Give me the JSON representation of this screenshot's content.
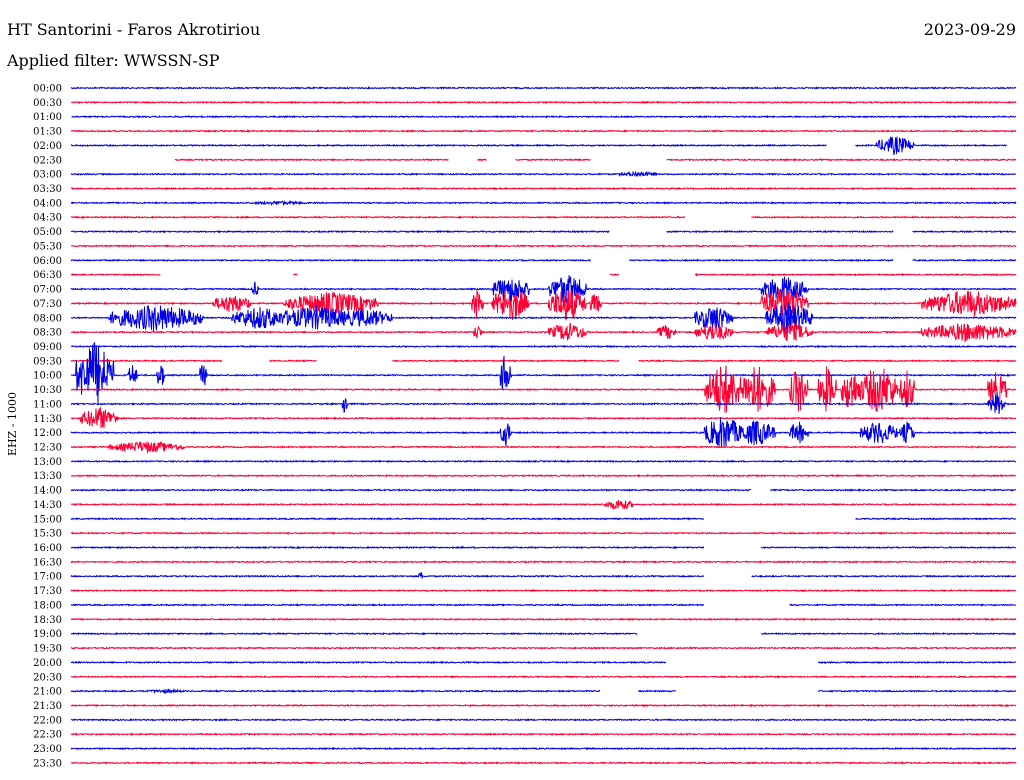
{
  "header": {
    "station": "HT Santorini - Faros Akrotiriou",
    "date": "2023-09-29",
    "filter": "Applied filter: WWSSN-SP"
  },
  "chart_data": {
    "type": "line",
    "title": "HT Santorini - Faros Akrotiriou",
    "subtitle": "Applied filter: WWSSN-SP",
    "ylabel": "EHZ - 1000",
    "colors": [
      "#0000e6",
      "#ff0033"
    ],
    "rows": [
      "00:00",
      "00:30",
      "01:00",
      "01:30",
      "02:00",
      "02:30",
      "03:00",
      "03:30",
      "04:00",
      "04:30",
      "05:00",
      "05:30",
      "06:00",
      "06:30",
      "07:00",
      "07:30",
      "08:00",
      "08:30",
      "09:00",
      "09:30",
      "10:00",
      "10:30",
      "11:00",
      "11:30",
      "12:00",
      "12:30",
      "13:00",
      "13:30",
      "14:00",
      "14:30",
      "15:00",
      "15:30",
      "16:00",
      "16:30",
      "17:00",
      "17:30",
      "18:00",
      "18:30",
      "19:00",
      "19:30",
      "20:00",
      "20:30",
      "21:00",
      "21:30",
      "22:00",
      "22:30",
      "23:00",
      "23:30"
    ],
    "gaps": {
      "2": [
        [
          0.0,
          0.0
        ]
      ],
      "4": [
        [
          0.8,
          0.83
        ],
        [
          0.99,
          1.0
        ]
      ],
      "5": [
        [
          0.0,
          0.11
        ],
        [
          0.4,
          0.43
        ],
        [
          0.44,
          0.47
        ],
        [
          0.55,
          0.63
        ]
      ],
      "9": [
        [
          0.65,
          0.72
        ]
      ],
      "10": [
        [
          0.57,
          0.63
        ],
        [
          0.87,
          0.89
        ]
      ],
      "12": [
        [
          0.55,
          0.59
        ],
        [
          0.87,
          0.89
        ]
      ],
      "13": [
        [
          0.095,
          0.235
        ],
        [
          0.24,
          0.57
        ],
        [
          0.58,
          0.66
        ]
      ],
      "19": [
        [
          0.16,
          0.21
        ],
        [
          0.26,
          0.34
        ],
        [
          0.58,
          0.6
        ]
      ],
      "28": [
        [
          0.72,
          0.74
        ]
      ],
      "30": [
        [
          0.67,
          0.83
        ]
      ],
      "32": [
        [
          0.67,
          0.73
        ]
      ],
      "34": [
        [
          0.67,
          0.72
        ]
      ],
      "36": [
        [
          0.67,
          0.76
        ]
      ],
      "38": [
        [
          0.6,
          0.73
        ]
      ],
      "40": [
        [
          0.63,
          0.79
        ]
      ],
      "42": [
        [
          0.56,
          0.6
        ],
        [
          0.64,
          0.79
        ]
      ]
    },
    "events": [
      {
        "row": 4,
        "x": 0.872,
        "amp": 10,
        "w": 0.02
      },
      {
        "row": 6,
        "x": 0.6,
        "amp": 3,
        "w": 0.02
      },
      {
        "row": 8,
        "x": 0.22,
        "amp": 2,
        "w": 0.03
      },
      {
        "row": 14,
        "x": 0.195,
        "amp": 8,
        "w": 0.004
      },
      {
        "row": 14,
        "x": 0.465,
        "amp": 14,
        "w": 0.02
      },
      {
        "row": 14,
        "x": 0.525,
        "amp": 16,
        "w": 0.02
      },
      {
        "row": 14,
        "x": 0.755,
        "amp": 14,
        "w": 0.025
      },
      {
        "row": 15,
        "x": 0.17,
        "amp": 10,
        "w": 0.02
      },
      {
        "row": 15,
        "x": 0.275,
        "amp": 12,
        "w": 0.05
      },
      {
        "row": 15,
        "x": 0.43,
        "amp": 16,
        "w": 0.006
      },
      {
        "row": 15,
        "x": 0.465,
        "amp": 18,
        "w": 0.02
      },
      {
        "row": 15,
        "x": 0.525,
        "amp": 18,
        "w": 0.02
      },
      {
        "row": 15,
        "x": 0.555,
        "amp": 12,
        "w": 0.006
      },
      {
        "row": 15,
        "x": 0.755,
        "amp": 18,
        "w": 0.025
      },
      {
        "row": 15,
        "x": 0.95,
        "amp": 14,
        "w": 0.05
      },
      {
        "row": 16,
        "x": 0.09,
        "amp": 14,
        "w": 0.05
      },
      {
        "row": 16,
        "x": 0.2,
        "amp": 12,
        "w": 0.03
      },
      {
        "row": 16,
        "x": 0.26,
        "amp": 12,
        "w": 0.05
      },
      {
        "row": 16,
        "x": 0.31,
        "amp": 10,
        "w": 0.03
      },
      {
        "row": 16,
        "x": 0.68,
        "amp": 14,
        "w": 0.02
      },
      {
        "row": 16,
        "x": 0.76,
        "amp": 16,
        "w": 0.025
      },
      {
        "row": 17,
        "x": 0.43,
        "amp": 8,
        "w": 0.005
      },
      {
        "row": 17,
        "x": 0.525,
        "amp": 10,
        "w": 0.02
      },
      {
        "row": 17,
        "x": 0.63,
        "amp": 8,
        "w": 0.01
      },
      {
        "row": 17,
        "x": 0.68,
        "amp": 10,
        "w": 0.02
      },
      {
        "row": 17,
        "x": 0.76,
        "amp": 10,
        "w": 0.025
      },
      {
        "row": 17,
        "x": 0.95,
        "amp": 10,
        "w": 0.05
      },
      {
        "row": 20,
        "x": 0.025,
        "amp": 36,
        "w": 0.02
      },
      {
        "row": 20,
        "x": 0.065,
        "amp": 12,
        "w": 0.005
      },
      {
        "row": 20,
        "x": 0.095,
        "amp": 16,
        "w": 0.004
      },
      {
        "row": 20,
        "x": 0.14,
        "amp": 14,
        "w": 0.004
      },
      {
        "row": 20,
        "x": 0.46,
        "amp": 24,
        "w": 0.006
      },
      {
        "row": 21,
        "x": 0.69,
        "amp": 28,
        "w": 0.02
      },
      {
        "row": 21,
        "x": 0.725,
        "amp": 26,
        "w": 0.02
      },
      {
        "row": 21,
        "x": 0.77,
        "amp": 24,
        "w": 0.01
      },
      {
        "row": 21,
        "x": 0.8,
        "amp": 24,
        "w": 0.01
      },
      {
        "row": 21,
        "x": 0.825,
        "amp": 24,
        "w": 0.01
      },
      {
        "row": 21,
        "x": 0.855,
        "amp": 26,
        "w": 0.02
      },
      {
        "row": 21,
        "x": 0.885,
        "amp": 22,
        "w": 0.008
      },
      {
        "row": 21,
        "x": 0.98,
        "amp": 20,
        "w": 0.01
      },
      {
        "row": 22,
        "x": 0.29,
        "amp": 14,
        "w": 0.003
      },
      {
        "row": 22,
        "x": 0.98,
        "amp": 12,
        "w": 0.01
      },
      {
        "row": 23,
        "x": 0.03,
        "amp": 12,
        "w": 0.02
      },
      {
        "row": 24,
        "x": 0.46,
        "amp": 14,
        "w": 0.006
      },
      {
        "row": 24,
        "x": 0.69,
        "amp": 18,
        "w": 0.02
      },
      {
        "row": 24,
        "x": 0.725,
        "amp": 14,
        "w": 0.02
      },
      {
        "row": 24,
        "x": 0.77,
        "amp": 12,
        "w": 0.01
      },
      {
        "row": 24,
        "x": 0.855,
        "amp": 12,
        "w": 0.02
      },
      {
        "row": 24,
        "x": 0.885,
        "amp": 12,
        "w": 0.008
      },
      {
        "row": 25,
        "x": 0.08,
        "amp": 6,
        "w": 0.04
      },
      {
        "row": 29,
        "x": 0.58,
        "amp": 6,
        "w": 0.015
      },
      {
        "row": 34,
        "x": 0.37,
        "amp": 6,
        "w": 0.002
      },
      {
        "row": 42,
        "x": 0.1,
        "amp": 2,
        "w": 0.02
      }
    ]
  }
}
